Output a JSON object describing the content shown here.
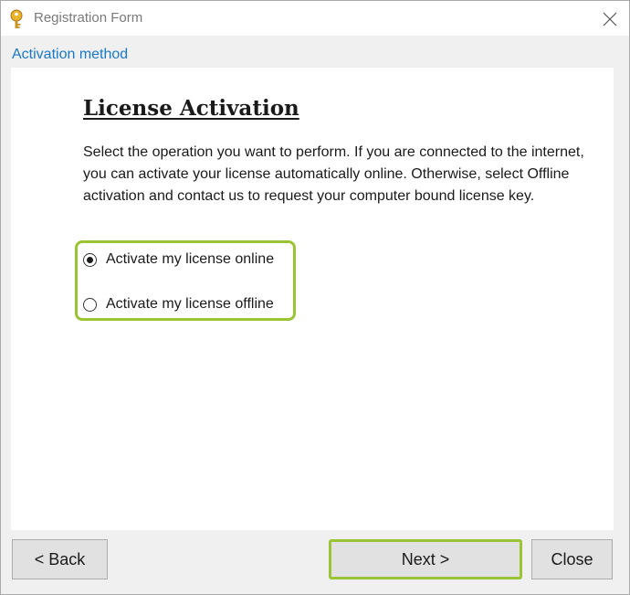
{
  "window": {
    "title": "Registration Form",
    "icon": "key-icon",
    "close_icon": "close-icon"
  },
  "section_header": "Activation method",
  "content": {
    "heading": "License Activation",
    "description": "Select the operation you want to perform. If you are connected to the internet, you can activate your license automatically online. Otherwise, select Offline activation and contact us to request your computer bound license key.",
    "options": [
      {
        "label": "Activate my license online",
        "checked": true
      },
      {
        "label": "Activate my license offline",
        "checked": false
      }
    ]
  },
  "buttons": {
    "back": "< Back",
    "next": "Next >",
    "close": "Close"
  },
  "colors": {
    "accent_highlight": "#9bc434",
    "section_header": "#1a78c8"
  }
}
